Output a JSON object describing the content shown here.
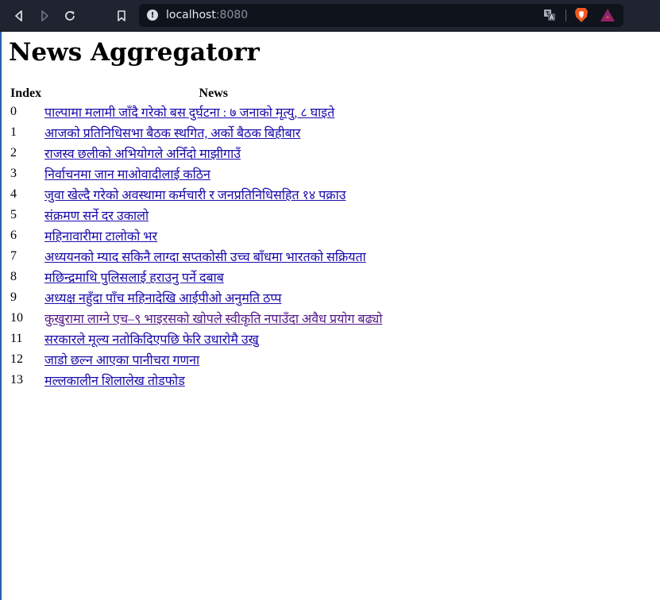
{
  "browser": {
    "url_host": "localhost",
    "url_port": ":8080"
  },
  "page": {
    "title": "News Aggregatorr",
    "table": {
      "headers": [
        "Index",
        "News"
      ],
      "rows": [
        {
          "index": "0",
          "headline": "पाल्पामा मलामी जाँदै गरेको बस दुर्घटना : ७ जनाको मृत्यु, ८ घाइते"
        },
        {
          "index": "1",
          "headline": "आजको प्रतिनिधिसभा बैठक स्थगित, अर्को बैठक बिहीबार"
        },
        {
          "index": "2",
          "headline": "राजस्व छलीको अभियोगले अनिँदो माझीगाउँ"
        },
        {
          "index": "3",
          "headline": "निर्वाचनमा जान माओवादीलाई कठिन"
        },
        {
          "index": "4",
          "headline": "जुवा खेल्दै गरेको अवस्थामा कर्मचारी र जनप्रतिनिधिसहित १४ पक्राउ"
        },
        {
          "index": "5",
          "headline": "संक्रमण सर्ने दर उकालो"
        },
        {
          "index": "6",
          "headline": "महिनावारीमा टालोको भर"
        },
        {
          "index": "7",
          "headline": "अध्ययनको म्याद सकिनै लाग्दा सप्तकोसी उच्च बाँधमा भारतको सक्रियता"
        },
        {
          "index": "8",
          "headline": "मछिन्द्रमाथि पुलिसलाई हराउनु पर्ने दबाब"
        },
        {
          "index": "9",
          "headline": "अध्यक्ष नहुँदा पाँच महिनादेखि आईपीओ अनुमति ठप्प"
        },
        {
          "index": "10",
          "headline": "कुखुरामा लाग्ने एच–९ भाइरसको खोपले स्वीकृति नपाउँदा अवैध प्रयोग बढ्यो"
        },
        {
          "index": "11",
          "headline": "सरकारले मूल्य नतोकिदिएपछि फेरि उधारोमै उखु"
        },
        {
          "index": "12",
          "headline": "जाडो छल्न आएका पानीचरा गणना"
        },
        {
          "index": "13",
          "headline": "मल्लकालीन शिलालेख तोडफोड"
        }
      ]
    }
  },
  "colors": {
    "toolbar_bg": "#1f2430",
    "link": "#1a0dab",
    "link_visited": "#551a8b"
  },
  "icons": [
    "back-icon",
    "forward-icon",
    "reload-icon",
    "bookmark-icon",
    "site-info-icon",
    "translate-icon",
    "brave-shield-icon",
    "brave-rewards-icon"
  ]
}
